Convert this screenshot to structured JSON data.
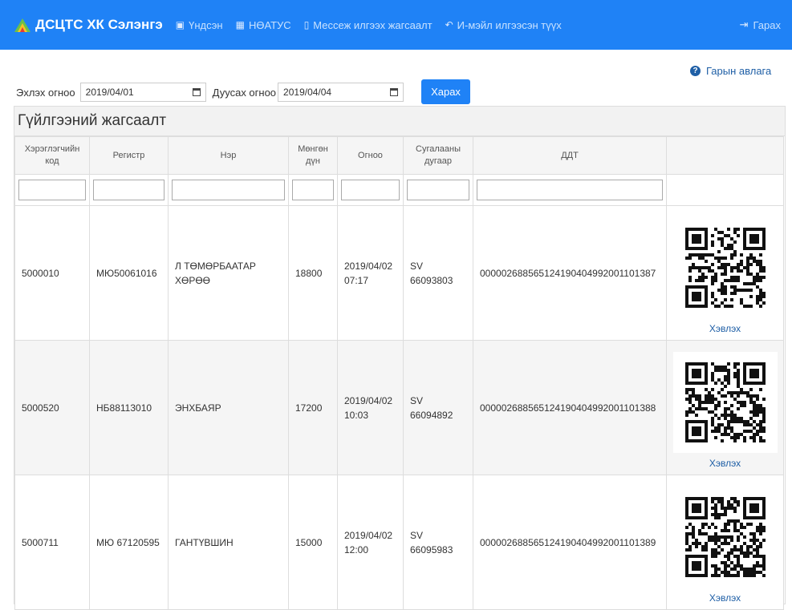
{
  "navbar": {
    "brand": "ДСЦТС ХК Сэлэнгэ",
    "items": [
      {
        "icon": "document-icon",
        "glyph": "▣",
        "label": "Үндсэн"
      },
      {
        "icon": "barcode-icon",
        "glyph": "▦",
        "label": "НӨАТУС"
      },
      {
        "icon": "mobile-icon",
        "glyph": "▯",
        "label": "Мессеж илгээх жагсаалт"
      },
      {
        "icon": "reply-icon",
        "glyph": "↶",
        "label": "И-мэйл илгээсэн түүх"
      }
    ],
    "logout": {
      "icon": "sign-out-icon",
      "label": "Гарах"
    }
  },
  "help": {
    "label": "Гарын авлага"
  },
  "filters": {
    "start_label": "Эхлэх огноо",
    "start_value": "2019/04/01",
    "end_label": "Дуусах огноо",
    "end_value": "2019/04/04",
    "submit_label": "Харах"
  },
  "panel": {
    "title": "Гүйлгээний жагсаалт"
  },
  "table": {
    "headers": [
      {
        "line1": "Хэрэглэгчийн",
        "line2": "код"
      },
      {
        "line1": "Регистр",
        "line2": ""
      },
      {
        "line1": "Нэр",
        "line2": ""
      },
      {
        "line1": "Мөнгөн",
        "line2": "дүн"
      },
      {
        "line1": "Огноо",
        "line2": ""
      },
      {
        "line1": "Сугалааны",
        "line2": "дугаар"
      },
      {
        "line1": "ДДТ",
        "line2": ""
      },
      {
        "line1": "",
        "line2": ""
      }
    ],
    "rows": [
      {
        "code": "5000010",
        "register": "МЮ50061016",
        "name_line1": "Л ТӨМӨРБААТАР",
        "name_line2": "ХӨРӨӨ",
        "amount": "18800",
        "date_line1": "2019/04/02",
        "date_line2": "07:17",
        "lottery_line1": "SV",
        "lottery_line2": "66093803",
        "ddt": "000002688565124190404992001101387",
        "print_label": "Хэвлэх"
      },
      {
        "code": "5000520",
        "register": "НБ88113010",
        "name_line1": "ЭНХБАЯР",
        "name_line2": "",
        "amount": "17200",
        "date_line1": "2019/04/02",
        "date_line2": "10:03",
        "lottery_line1": "SV",
        "lottery_line2": "66094892",
        "ddt": "000002688565124190404992001101388",
        "print_label": "Хэвлэх"
      },
      {
        "code": "5000711",
        "register": "МЮ 67120595",
        "name_line1": "ГАНТҮВШИН",
        "name_line2": "",
        "amount": "15000",
        "date_line1": "2019/04/02",
        "date_line2": "12:00",
        "lottery_line1": "SV",
        "lottery_line2": "66095983",
        "ddt": "000002688565124190404992001101389",
        "print_label": "Хэвлэх"
      }
    ]
  }
}
